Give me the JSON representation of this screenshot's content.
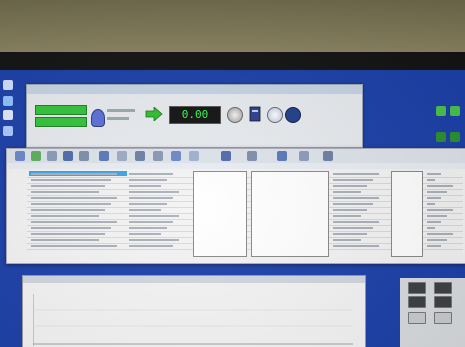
{
  "control_panel": {
    "display_value": "0.00"
  }
}
